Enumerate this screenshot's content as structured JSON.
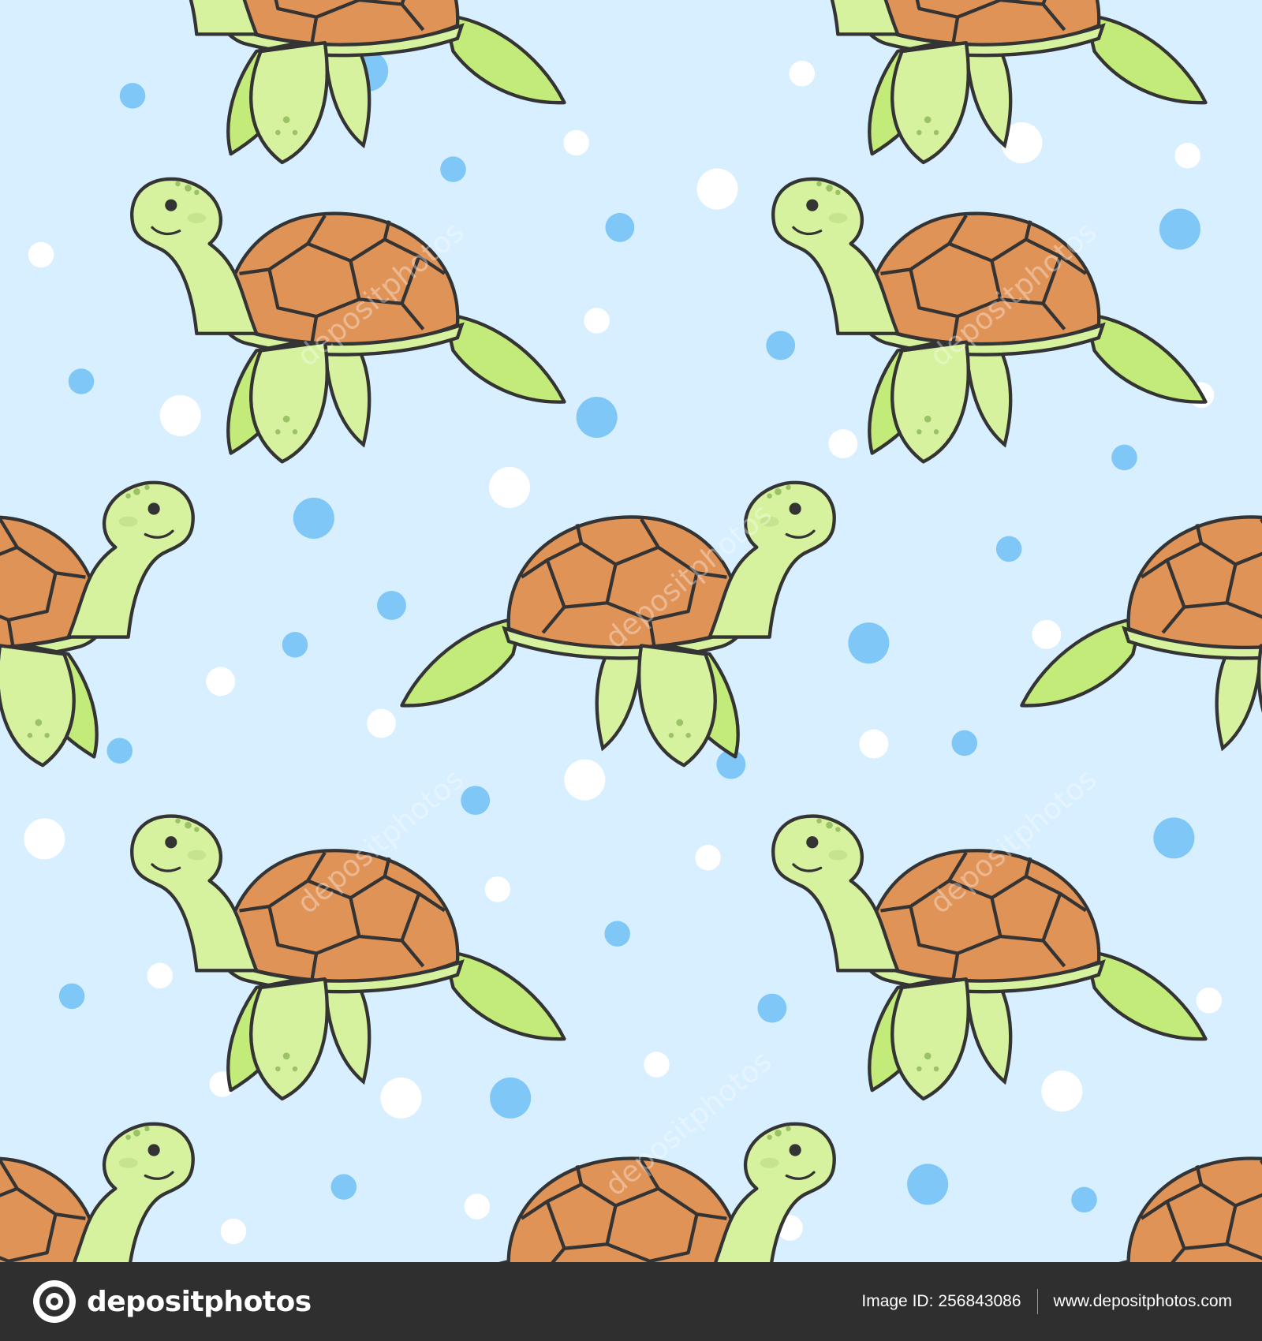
{
  "image": {
    "subject": "seamless pattern of cartoon green sea turtles on light blue background with bubbles",
    "colors": {
      "background": "#d7efff",
      "skin": "#d6f29e",
      "flipper": "#c2eb7a",
      "shell": "#e09357",
      "outline": "#343434",
      "spots": "#9cc266",
      "blue_bubble": "#7fc7f6",
      "white_bubble": "#ffffff"
    }
  },
  "watermark": {
    "text": "depositphotos"
  },
  "footer": {
    "brand": "depositphotos",
    "image_id_label": "Image ID:",
    "image_id": "256843086",
    "site": "www.depositphotos.com"
  }
}
